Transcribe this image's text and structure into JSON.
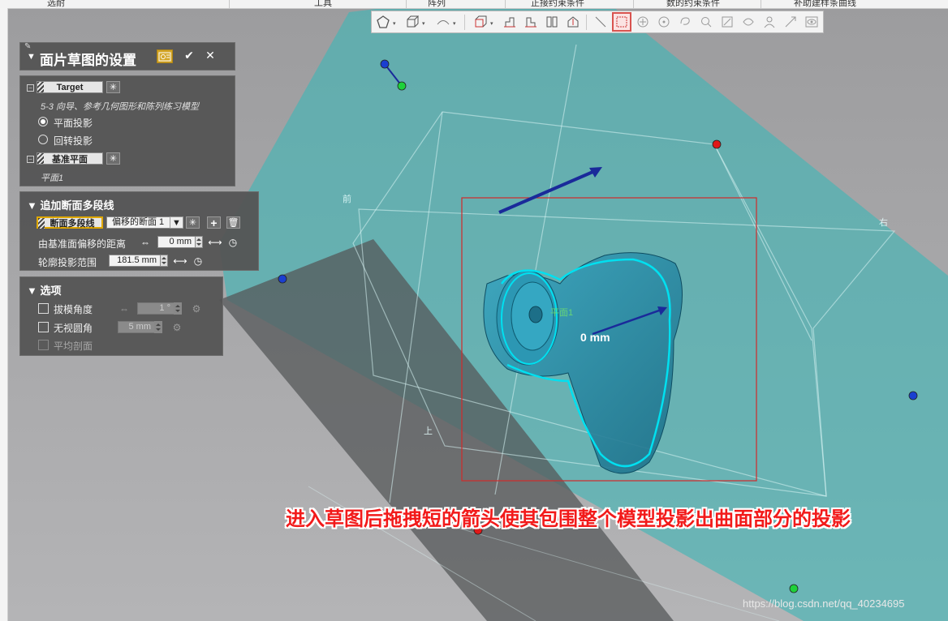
{
  "menubar": {
    "items": [
      "选耐",
      "工具",
      "阵列",
      "正接约束条件",
      "数的约束条件",
      "补助建样条曲线"
    ]
  },
  "toolbar": {
    "icons": [
      "polygon-icon",
      "box-icon",
      "arc-icon",
      "cube-view-icon",
      "section-icon-1",
      "section-icon-2",
      "split-icon",
      "measure-icon",
      "line-icon",
      "select-rect-icon",
      "circle-snap-icon",
      "circle-add-icon",
      "lasso-icon",
      "zoom-icon",
      "sketch-icon",
      "face-icon",
      "person-icon",
      "move-icon",
      "eye-icon"
    ]
  },
  "dialog": {
    "title": "面片草图的设置",
    "ok_symbol": "✔",
    "cancel_symbol": "✕"
  },
  "target_section": {
    "label": "Target",
    "model_name": "5-3 向导、参考几何图形和陈列练习模型",
    "radio_plane": "平面投影",
    "radio_rotate": "回转投影",
    "base_plane_label": "基准平面",
    "base_plane_value": "平面1"
  },
  "polyline_section": {
    "header": "追加断面多段线",
    "polyline_label": "断面多段线",
    "polyline_select": "偏移的断面 1",
    "offset_label": "由基准面偏移的距离",
    "offset_value": "0 mm",
    "range_label": "轮廓投影范围",
    "range_value": "181.5 mm"
  },
  "options_section": {
    "header": "选项",
    "draft_label": "拔模角度",
    "draft_value": "1 °",
    "ignore_fillet_label": "无视圆角",
    "ignore_fillet_value": "5 mm",
    "avg_section_label": "平均剖面"
  },
  "viewport": {
    "dimension_label": "0 mm",
    "view_labels": {
      "front": "前",
      "right": "右",
      "top": "上",
      "plane": "平面1"
    },
    "colors": {
      "plane": "#3fb7b7",
      "model": "#2a8ea8",
      "highlight": "#00e0f0",
      "arrow": "#1a2a9a",
      "box": "#d12a2a"
    }
  },
  "caption": "进入草图后拖拽短的箭头使其包围整个模型投影出曲面部分的投影",
  "watermark": "https://blog.csdn.net/qq_40234695"
}
